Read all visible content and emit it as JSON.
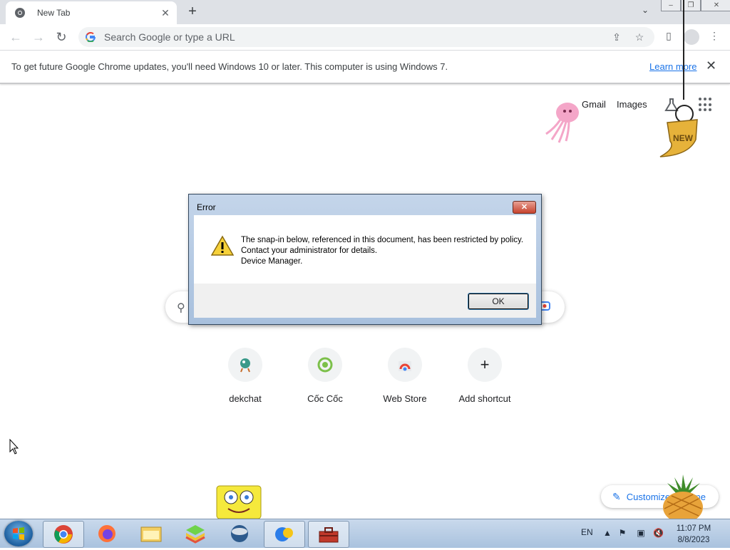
{
  "browser": {
    "tab_title": "New Tab",
    "omnibox_placeholder": "Search Google or type a URL",
    "infobar_message": "To get future Google Chrome updates, you'll need Windows 10 or later. This computer is using Windows 7.",
    "infobar_link": "Learn more"
  },
  "ntp": {
    "top_links": [
      "Gmail",
      "Images"
    ],
    "shortcuts": [
      {
        "label": "dekchat",
        "icon": "dekchat-icon"
      },
      {
        "label": "Cốc Cốc",
        "icon": "coccoc-icon"
      },
      {
        "label": "Web Store",
        "icon": "webstore-icon"
      },
      {
        "label": "Add shortcut",
        "icon": "plus-icon"
      }
    ],
    "customize_label": "Customize Chrome"
  },
  "dialog": {
    "title": "Error",
    "message_line1": "The snap-in below, referenced in this document, has been restricted by policy. Contact your administrator for details.",
    "message_line2": "Device Manager.",
    "ok_label": "OK"
  },
  "decorations": {
    "new_badge_text": "NEW"
  },
  "taskbar": {
    "language": "EN",
    "time": "11:07 PM",
    "date": "8/8/2023",
    "pinned": [
      "chrome-icon",
      "firefox-icon",
      "file-explorer-icon",
      "bluestacks-icon",
      "vpn-icon",
      "app-icon",
      "toolbox-icon"
    ]
  },
  "colors": {
    "accent": "#1a73e8",
    "taskbar": "#b7cde6",
    "dialog_frame": "#b4c9e3"
  }
}
